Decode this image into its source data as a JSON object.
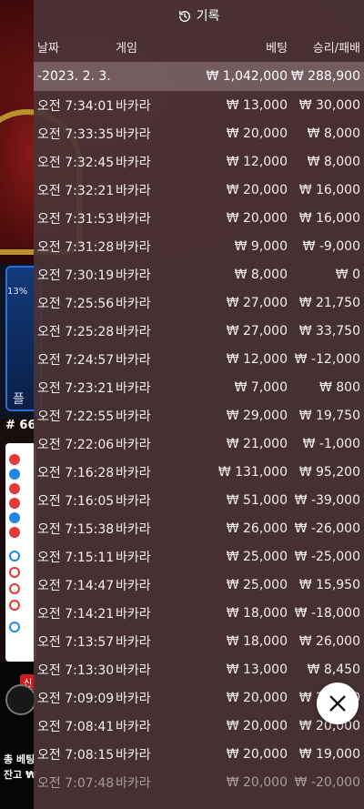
{
  "background": {
    "bet_percent": "13%",
    "round_label": "# 66",
    "new_badge": "신",
    "total_bet_label": "총 베팅",
    "balance_label": "잔고 ₩"
  },
  "panel": {
    "title": "기록",
    "columns": {
      "date": "날짜",
      "game": "게임",
      "bet": "베팅",
      "win": "승리/패배"
    },
    "summary": {
      "date": "-2023. 2. 3.",
      "bet": "₩ 1,042,000",
      "win": "₩ 288,900"
    },
    "rows": [
      {
        "time": "오전 7:34:01",
        "game": "바카라",
        "bet": "₩ 13,000",
        "win": "₩ 30,000"
      },
      {
        "time": "오전 7:33:35",
        "game": "바카라",
        "bet": "₩ 20,000",
        "win": "₩ 8,000"
      },
      {
        "time": "오전 7:32:45",
        "game": "바카라",
        "bet": "₩ 12,000",
        "win": "₩ 8,000"
      },
      {
        "time": "오전 7:32:21",
        "game": "바카라",
        "bet": "₩ 20,000",
        "win": "₩ 16,000"
      },
      {
        "time": "오전 7:31:53",
        "game": "바카라",
        "bet": "₩ 20,000",
        "win": "₩ 16,000"
      },
      {
        "time": "오전 7:31:28",
        "game": "바카라",
        "bet": "₩ 9,000",
        "win": "₩ -9,000"
      },
      {
        "time": "오전 7:30:19",
        "game": "바카라",
        "bet": "₩ 8,000",
        "win": "₩ 0"
      },
      {
        "time": "오전 7:25:56",
        "game": "바카라",
        "bet": "₩ 27,000",
        "win": "₩ 21,750"
      },
      {
        "time": "오전 7:25:28",
        "game": "바카라",
        "bet": "₩ 27,000",
        "win": "₩ 33,750"
      },
      {
        "time": "오전 7:24:57",
        "game": "바카라",
        "bet": "₩ 12,000",
        "win": "₩ -12,000"
      },
      {
        "time": "오전 7:23:21",
        "game": "바카라",
        "bet": "₩ 7,000",
        "win": "₩ 800"
      },
      {
        "time": "오전 7:22:55",
        "game": "바카라",
        "bet": "₩ 29,000",
        "win": "₩ 19,750"
      },
      {
        "time": "오전 7:22:06",
        "game": "바카라",
        "bet": "₩ 21,000",
        "win": "₩ -1,000"
      },
      {
        "time": "오전 7:16:28",
        "game": "바카라",
        "bet": "₩ 131,000",
        "win": "₩ 95,200"
      },
      {
        "time": "오전 7:16:05",
        "game": "바카라",
        "bet": "₩ 51,000",
        "win": "₩ -39,000"
      },
      {
        "time": "오전 7:15:38",
        "game": "바카라",
        "bet": "₩ 26,000",
        "win": "₩ -26,000"
      },
      {
        "time": "오전 7:15:11",
        "game": "바카라",
        "bet": "₩ 25,000",
        "win": "₩ -25,000"
      },
      {
        "time": "오전 7:14:47",
        "game": "바카라",
        "bet": "₩ 25,000",
        "win": "₩ 15,950"
      },
      {
        "time": "오전 7:14:21",
        "game": "바카라",
        "bet": "₩ 18,000",
        "win": "₩ -18,000"
      },
      {
        "time": "오전 7:13:57",
        "game": "바카라",
        "bet": "₩ 18,000",
        "win": "₩ 26,000"
      },
      {
        "time": "오전 7:13:30",
        "game": "바카라",
        "bet": "₩ 13,000",
        "win": "₩ 8,450"
      },
      {
        "time": "오전 7:09:09",
        "game": "바카라",
        "bet": "₩ 20,000",
        "win": "₩ 20,000"
      },
      {
        "time": "오전 7:08:41",
        "game": "바카라",
        "bet": "₩ 20,000",
        "win": "₩ 20,000"
      },
      {
        "time": "오전 7:08:15",
        "game": "바카라",
        "bet": "₩ 20,000",
        "win": "₩ 19,000"
      },
      {
        "time": "오전 7:07:48",
        "game": "바카라",
        "bet": "₩ 20,000",
        "win": "₩ -20,000"
      }
    ]
  },
  "colors": {
    "panel_bg": "#4a3436",
    "summary_bg": "#968286",
    "close_bg": "#ffffff"
  },
  "icons": {
    "header": "history-icon",
    "close": "close-icon"
  }
}
